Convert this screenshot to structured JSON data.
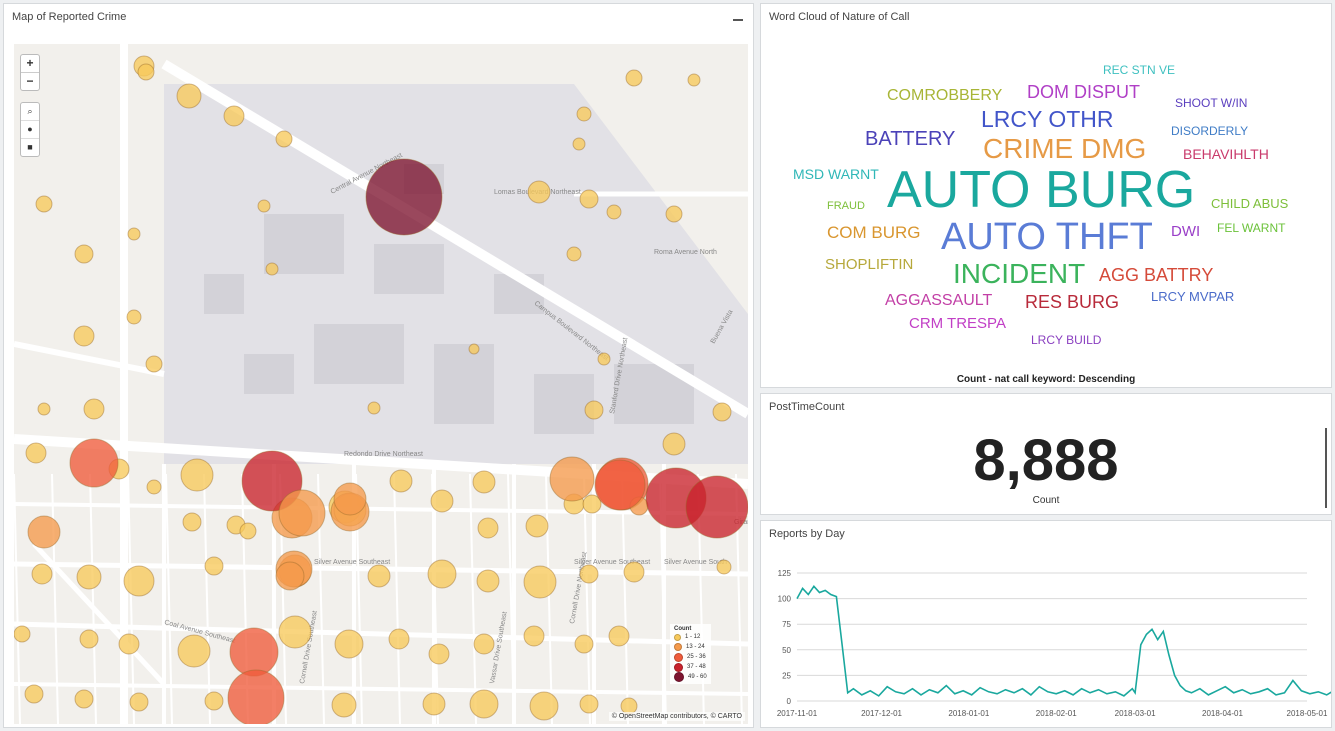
{
  "map": {
    "title": "Map of Reported Crime",
    "zoom_in": "+",
    "zoom_out": "−",
    "attribution": "© OpenStreetMap contributors, © CARTO",
    "legend_title": "Count",
    "legend_items": [
      "1 - 12",
      "13 - 24",
      "25 - 36",
      "37 - 48",
      "49 - 60"
    ],
    "streets": [
      "Central Avenue Northeast",
      "Redondo Drive Northeast",
      "Silver Avenue Southeast",
      "Silver Avenue Southeast",
      "Silver Avenue South",
      "Coal Avenue Southeast",
      "Lomas Boulevard Northeast",
      "Roma Avenue North",
      "Campus Boulevard Northeast",
      "Cornell Drive Southeast",
      "Stanford Drive Northeast",
      "Girard",
      "Vassar Drive Southeast",
      "Buena Vista",
      "Cornell Drive Northeast"
    ],
    "colors": {
      "c1": "#f7c95b",
      "c2": "#f59a4b",
      "c3": "#ef5b3b",
      "c4": "#c9222c",
      "c5": "#7e1530"
    }
  },
  "wordcloud": {
    "title": "Word Cloud of Nature of Call",
    "footer": "Count - nat call keyword: Descending",
    "words": [
      {
        "text": "REC STN VE",
        "color": "#3ec0c0"
      },
      {
        "text": "DOM DISPUT",
        "color": "#b03fc6"
      },
      {
        "text": "COMROBBERY",
        "color": "#a8b536"
      },
      {
        "text": "SHOOT W/IN",
        "color": "#5b3fbf"
      },
      {
        "text": "LRCY OTHR",
        "color": "#4255c9"
      },
      {
        "text": "BATTERY",
        "color": "#4b42b8"
      },
      {
        "text": "DISORDERLY",
        "color": "#3f7cc6"
      },
      {
        "text": "CRIME DMG",
        "color": "#e69a46"
      },
      {
        "text": "BEHAVIHLTH",
        "color": "#c93a6b"
      },
      {
        "text": "MSD WARNT",
        "color": "#2fb7b7"
      },
      {
        "text": "AUTO BURG",
        "color": "#1aa89e"
      },
      {
        "text": "FRAUD",
        "color": "#7dbf3a"
      },
      {
        "text": "CHILD ABUS",
        "color": "#7dbf3a"
      },
      {
        "text": "COM BURG",
        "color": "#d9962f"
      },
      {
        "text": "AUTO THFT",
        "color": "#5a7cd6"
      },
      {
        "text": "DWI",
        "color": "#9a3fc8"
      },
      {
        "text": "FEL WARNT",
        "color": "#6bc23a"
      },
      {
        "text": "SHOPLIFTIN",
        "color": "#b6a83a"
      },
      {
        "text": "INCIDENT",
        "color": "#3bb35c"
      },
      {
        "text": "AGG BATTRY",
        "color": "#d54b3a"
      },
      {
        "text": "AGGASSAULT",
        "color": "#c23fa6"
      },
      {
        "text": "RES BURG",
        "color": "#b82a3a"
      },
      {
        "text": "LRCY MVPAR",
        "color": "#4a6bc9"
      },
      {
        "text": "CRM TRESPA",
        "color": "#c13fc6"
      },
      {
        "text": "LRCY BUILD",
        "color": "#8a3fc0"
      }
    ]
  },
  "kpi": {
    "title": "PostTimeCount",
    "value": "8,888",
    "label": "Count"
  },
  "chart_data": {
    "type": "line",
    "title": "Reports by Day",
    "color": "#1aa89e",
    "ylim": [
      0,
      125
    ],
    "yticks": [
      0,
      25,
      50,
      75,
      100,
      125
    ],
    "xticks": [
      "2017-11-01",
      "2017-12-01",
      "2018-01-01",
      "2018-02-01",
      "2018-03-01",
      "2018-04-01",
      "2018-05-01"
    ],
    "series": [
      {
        "x": [
          "2017-11-01",
          "2017-11-03",
          "2017-11-05",
          "2017-11-07",
          "2017-11-09",
          "2017-11-11",
          "2017-11-13",
          "2017-11-15",
          "2017-11-17",
          "2017-11-19",
          "2017-11-21",
          "2017-11-24",
          "2017-11-27",
          "2017-11-30",
          "2017-12-03",
          "2017-12-06",
          "2017-12-09",
          "2017-12-12",
          "2017-12-15",
          "2017-12-18",
          "2017-12-21",
          "2017-12-24",
          "2017-12-27",
          "2017-12-30",
          "2018-01-02",
          "2018-01-05",
          "2018-01-08",
          "2018-01-11",
          "2018-01-14",
          "2018-01-17",
          "2018-01-20",
          "2018-01-23",
          "2018-01-26",
          "2018-01-29",
          "2018-02-01",
          "2018-02-04",
          "2018-02-07",
          "2018-02-10",
          "2018-02-13",
          "2018-02-16",
          "2018-02-19",
          "2018-02-22",
          "2018-02-25",
          "2018-02-28",
          "2018-03-01",
          "2018-03-03",
          "2018-03-05",
          "2018-03-07",
          "2018-03-09",
          "2018-03-11",
          "2018-03-13",
          "2018-03-15",
          "2018-03-17",
          "2018-03-19",
          "2018-03-21",
          "2018-03-24",
          "2018-03-27",
          "2018-03-30",
          "2018-04-02",
          "2018-04-05",
          "2018-04-08",
          "2018-04-11",
          "2018-04-14",
          "2018-04-17",
          "2018-04-20",
          "2018-04-23",
          "2018-04-26",
          "2018-04-29",
          "2018-05-02",
          "2018-05-05",
          "2018-05-08",
          "2018-05-11",
          "2018-05-14",
          "2018-05-17"
        ],
        "y": [
          100,
          110,
          104,
          112,
          106,
          108,
          104,
          102,
          55,
          8,
          12,
          6,
          10,
          5,
          14,
          9,
          7,
          12,
          6,
          11,
          8,
          15,
          7,
          10,
          6,
          13,
          9,
          7,
          11,
          8,
          12,
          6,
          14,
          9,
          7,
          10,
          6,
          12,
          8,
          11,
          7,
          9,
          5,
          12,
          8,
          55,
          65,
          70,
          60,
          68,
          45,
          25,
          15,
          10,
          8,
          12,
          6,
          10,
          14,
          8,
          11,
          7,
          9,
          12,
          6,
          8,
          20,
          10,
          7,
          9,
          6,
          11,
          8,
          5
        ]
      }
    ]
  }
}
